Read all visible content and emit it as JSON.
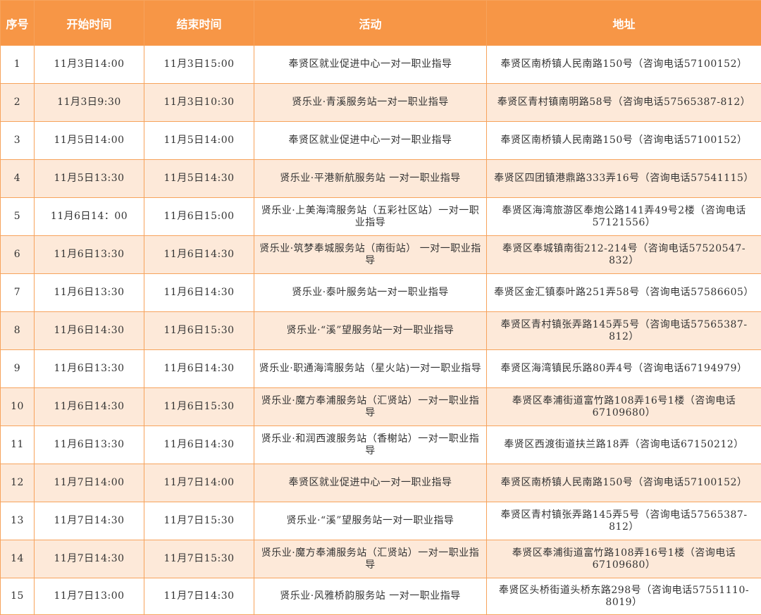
{
  "table": {
    "headers": [
      "序号",
      "开始时间",
      "结束时间",
      "活动",
      "地址"
    ],
    "rows": [
      [
        "1",
        "11月3日14:00",
        "11月3日15:00",
        "奉贤区就业促进中心一对一职业指导",
        "奉贤区南桥镇人民南路150号（咨询电话57100152）"
      ],
      [
        "2",
        "11月3日9:30",
        "11月3日10:30",
        "贤乐业·青溪服务站一对一职业指导",
        "奉贤区青村镇南明路58号（咨询电话57565387-812）"
      ],
      [
        "3",
        "11月5日14:00",
        "11月5日14:00",
        "奉贤区就业促进中心一对一职业指导",
        "奉贤区南桥镇人民南路150号（咨询电话57100152）"
      ],
      [
        "4",
        "11月5日13:30",
        "11月5日14:30",
        "贤乐业·平港新航服务站 一对一职业指导",
        "奉贤区四团镇港鼎路333弄16号（咨询电话57541115）"
      ],
      [
        "5",
        "11月6日14：00",
        "11月6日15:00",
        "贤乐业·上美海湾服务站（五彩社区站）一对一职业指导",
        "奉贤区海湾旅游区奉炮公路141弄49号2楼（咨询电话57121556）"
      ],
      [
        "6",
        "11月6日13:30",
        "11月6日14:30",
        "贤乐业·筑梦奉城服务站（南街站） 一对一职业指导",
        "奉贤区奉城镇南街212-214号（咨询电话57520547-832）"
      ],
      [
        "7",
        "11月6日13:30",
        "11月6日14:30",
        "贤乐业·泰叶服务站一对一职业指导",
        "奉贤区金汇镇泰叶路251弄58号（咨询电话57586605）"
      ],
      [
        "8",
        "11月6日14:30",
        "11月6日15:30",
        "贤乐业·“溪”望服务站一对一职业指导",
        "奉贤区青村镇张弄路145弄5号（咨询电话57565387-812）"
      ],
      [
        "9",
        "11月6日13:30",
        "11月6日14:30",
        "贤乐业·职通海湾服务站（星火站)一对一职业指导",
        "奉贤区海湾镇民乐路80弄4号（咨询电话67194979）"
      ],
      [
        "10",
        "11月6日14:30",
        "11月6日15:30",
        "贤乐业·魔方奉浦服务站（汇贤站）一对一职业指导",
        "奉贤区奉浦街道富竹路108弄16号1楼（咨询电话67109680）"
      ],
      [
        "11",
        "11月6日13:30",
        "11月6日14:30",
        "贤乐业·和润西渡服务站（香榭站）一对一职业指导",
        "奉贤区西渡街道扶兰路18弄（咨询电话67150212）"
      ],
      [
        "12",
        "11月7日14:00",
        "11月7日14:00",
        "奉贤区就业促进中心一对一职业指导",
        "奉贤区南桥镇人民南路150号（咨询电话57100152）"
      ],
      [
        "13",
        "11月7日14:30",
        "11月7日15:30",
        "贤乐业·“溪”望服务站一对一职业指导",
        "奉贤区青村镇张弄路145弄5号（咨询电话57565387-812）"
      ],
      [
        "14",
        "11月7日14:30",
        "11月7日15:30",
        "贤乐业·魔方奉浦服务站（汇贤站）一对一职业指导",
        "奉贤区奉浦街道富竹路108弄16号1楼（咨询电话67109680）"
      ],
      [
        "15",
        "11月7日13:00",
        "11月7日14:30",
        "贤乐业·风雅桥韵服务站 一对一职业指导",
        "奉贤区头桥街道头桥东路298号（咨询电话57551110-8019）"
      ]
    ]
  },
  "colors": {
    "header_bg": "#f79646",
    "header_text": "#ffffff",
    "row_alt_bg": "#fde9d9",
    "border": "#f7a35c"
  }
}
